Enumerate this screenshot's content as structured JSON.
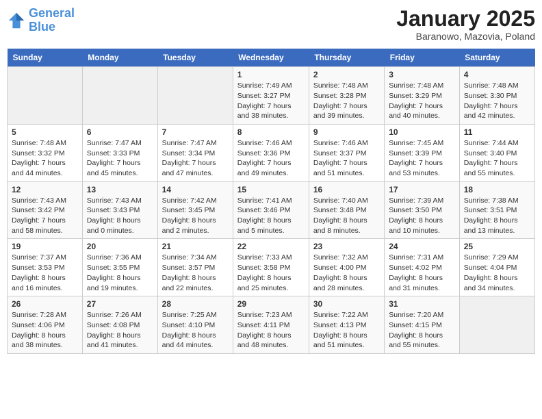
{
  "header": {
    "logo_line1": "General",
    "logo_line2": "Blue",
    "month": "January 2025",
    "location": "Baranowo, Mazovia, Poland"
  },
  "weekdays": [
    "Sunday",
    "Monday",
    "Tuesday",
    "Wednesday",
    "Thursday",
    "Friday",
    "Saturday"
  ],
  "weeks": [
    [
      {
        "day": "",
        "info": ""
      },
      {
        "day": "",
        "info": ""
      },
      {
        "day": "",
        "info": ""
      },
      {
        "day": "1",
        "info": "Sunrise: 7:49 AM\nSunset: 3:27 PM\nDaylight: 7 hours\nand 38 minutes."
      },
      {
        "day": "2",
        "info": "Sunrise: 7:48 AM\nSunset: 3:28 PM\nDaylight: 7 hours\nand 39 minutes."
      },
      {
        "day": "3",
        "info": "Sunrise: 7:48 AM\nSunset: 3:29 PM\nDaylight: 7 hours\nand 40 minutes."
      },
      {
        "day": "4",
        "info": "Sunrise: 7:48 AM\nSunset: 3:30 PM\nDaylight: 7 hours\nand 42 minutes."
      }
    ],
    [
      {
        "day": "5",
        "info": "Sunrise: 7:48 AM\nSunset: 3:32 PM\nDaylight: 7 hours\nand 44 minutes."
      },
      {
        "day": "6",
        "info": "Sunrise: 7:47 AM\nSunset: 3:33 PM\nDaylight: 7 hours\nand 45 minutes."
      },
      {
        "day": "7",
        "info": "Sunrise: 7:47 AM\nSunset: 3:34 PM\nDaylight: 7 hours\nand 47 minutes."
      },
      {
        "day": "8",
        "info": "Sunrise: 7:46 AM\nSunset: 3:36 PM\nDaylight: 7 hours\nand 49 minutes."
      },
      {
        "day": "9",
        "info": "Sunrise: 7:46 AM\nSunset: 3:37 PM\nDaylight: 7 hours\nand 51 minutes."
      },
      {
        "day": "10",
        "info": "Sunrise: 7:45 AM\nSunset: 3:39 PM\nDaylight: 7 hours\nand 53 minutes."
      },
      {
        "day": "11",
        "info": "Sunrise: 7:44 AM\nSunset: 3:40 PM\nDaylight: 7 hours\nand 55 minutes."
      }
    ],
    [
      {
        "day": "12",
        "info": "Sunrise: 7:43 AM\nSunset: 3:42 PM\nDaylight: 7 hours\nand 58 minutes."
      },
      {
        "day": "13",
        "info": "Sunrise: 7:43 AM\nSunset: 3:43 PM\nDaylight: 8 hours\nand 0 minutes."
      },
      {
        "day": "14",
        "info": "Sunrise: 7:42 AM\nSunset: 3:45 PM\nDaylight: 8 hours\nand 2 minutes."
      },
      {
        "day": "15",
        "info": "Sunrise: 7:41 AM\nSunset: 3:46 PM\nDaylight: 8 hours\nand 5 minutes."
      },
      {
        "day": "16",
        "info": "Sunrise: 7:40 AM\nSunset: 3:48 PM\nDaylight: 8 hours\nand 8 minutes."
      },
      {
        "day": "17",
        "info": "Sunrise: 7:39 AM\nSunset: 3:50 PM\nDaylight: 8 hours\nand 10 minutes."
      },
      {
        "day": "18",
        "info": "Sunrise: 7:38 AM\nSunset: 3:51 PM\nDaylight: 8 hours\nand 13 minutes."
      }
    ],
    [
      {
        "day": "19",
        "info": "Sunrise: 7:37 AM\nSunset: 3:53 PM\nDaylight: 8 hours\nand 16 minutes."
      },
      {
        "day": "20",
        "info": "Sunrise: 7:36 AM\nSunset: 3:55 PM\nDaylight: 8 hours\nand 19 minutes."
      },
      {
        "day": "21",
        "info": "Sunrise: 7:34 AM\nSunset: 3:57 PM\nDaylight: 8 hours\nand 22 minutes."
      },
      {
        "day": "22",
        "info": "Sunrise: 7:33 AM\nSunset: 3:58 PM\nDaylight: 8 hours\nand 25 minutes."
      },
      {
        "day": "23",
        "info": "Sunrise: 7:32 AM\nSunset: 4:00 PM\nDaylight: 8 hours\nand 28 minutes."
      },
      {
        "day": "24",
        "info": "Sunrise: 7:31 AM\nSunset: 4:02 PM\nDaylight: 8 hours\nand 31 minutes."
      },
      {
        "day": "25",
        "info": "Sunrise: 7:29 AM\nSunset: 4:04 PM\nDaylight: 8 hours\nand 34 minutes."
      }
    ],
    [
      {
        "day": "26",
        "info": "Sunrise: 7:28 AM\nSunset: 4:06 PM\nDaylight: 8 hours\nand 38 minutes."
      },
      {
        "day": "27",
        "info": "Sunrise: 7:26 AM\nSunset: 4:08 PM\nDaylight: 8 hours\nand 41 minutes."
      },
      {
        "day": "28",
        "info": "Sunrise: 7:25 AM\nSunset: 4:10 PM\nDaylight: 8 hours\nand 44 minutes."
      },
      {
        "day": "29",
        "info": "Sunrise: 7:23 AM\nSunset: 4:11 PM\nDaylight: 8 hours\nand 48 minutes."
      },
      {
        "day": "30",
        "info": "Sunrise: 7:22 AM\nSunset: 4:13 PM\nDaylight: 8 hours\nand 51 minutes."
      },
      {
        "day": "31",
        "info": "Sunrise: 7:20 AM\nSunset: 4:15 PM\nDaylight: 8 hours\nand 55 minutes."
      },
      {
        "day": "",
        "info": ""
      }
    ]
  ]
}
